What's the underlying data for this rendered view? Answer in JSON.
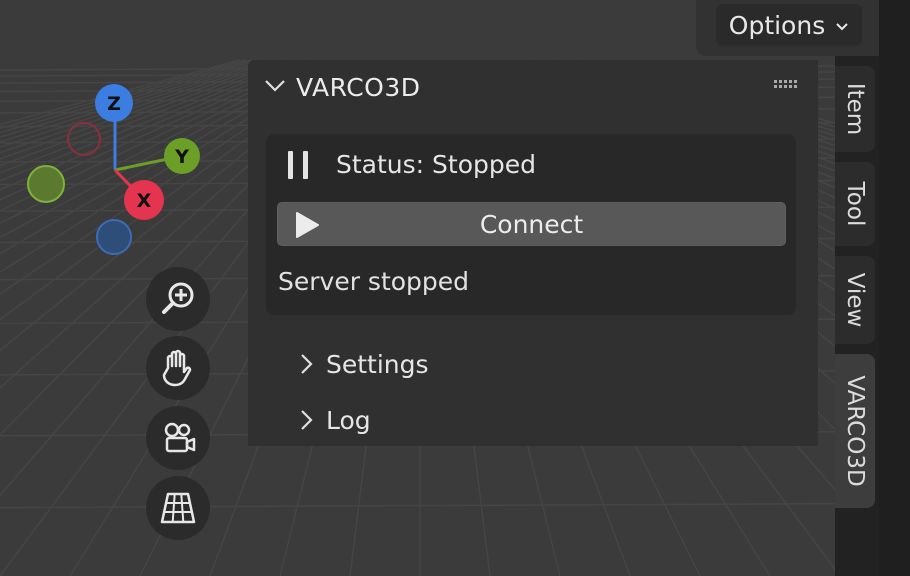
{
  "header": {
    "options_label": "Options"
  },
  "gizmo": {
    "z": "Z",
    "y": "Y",
    "x": "X"
  },
  "nav_buttons": [
    {
      "name": "zoom-icon"
    },
    {
      "name": "hand-icon"
    },
    {
      "name": "camera-icon"
    },
    {
      "name": "grid-view-icon"
    }
  ],
  "panel": {
    "title": "VARCO3D",
    "status_text": "Status: Stopped",
    "connect_label": "Connect",
    "server_text": "Server stopped",
    "subpanels": [
      "Settings",
      "Log"
    ]
  },
  "tabs": [
    "Item",
    "Tool",
    "View",
    "VARCO3D"
  ],
  "colors": {
    "axis_x": "#e4344f",
    "axis_y": "#6c9f26",
    "axis_z": "#3b7de0",
    "panel_bg": "#303030",
    "button_bg": "#585858"
  }
}
